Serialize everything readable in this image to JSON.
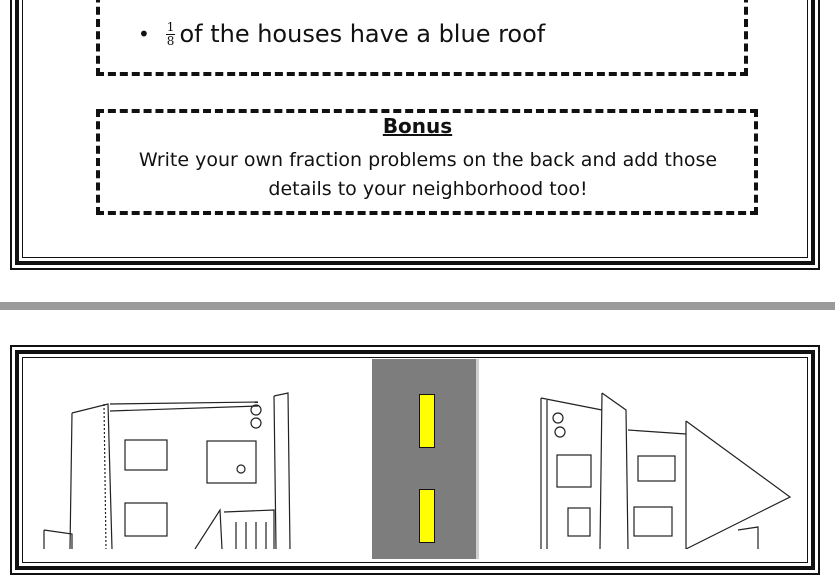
{
  "list": {
    "bullet": "•",
    "fraction_numerator": "1",
    "fraction_denominator": "8",
    "item_text": "of the houses have a blue roof"
  },
  "bonus": {
    "title": "Bonus",
    "text": "Write your own fraction problems on the back and add those details to your neighborhood too!"
  },
  "colors": {
    "road": "#7d7d7d",
    "lane_marking": "#ffff00",
    "separator": "#9a9a9a"
  },
  "icons": [
    "house-left-drawing",
    "house-right-drawing",
    "flower-icon",
    "road-illustration"
  ]
}
